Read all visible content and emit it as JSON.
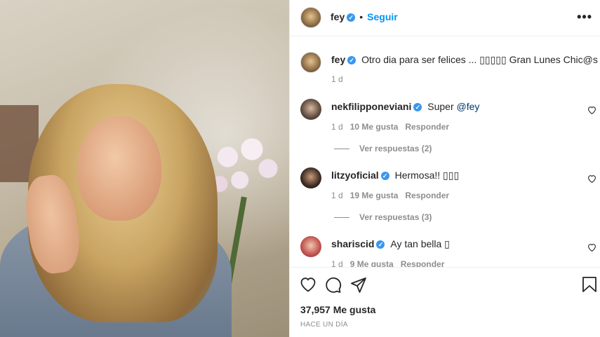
{
  "post": {
    "photo_alt": "post-photo",
    "author": "fey",
    "follow_label": "Seguir",
    "more_label": "•••"
  },
  "caption": {
    "author": "fey",
    "text": "Otro dia para ser felices ... ▯▯▯▯▯ Gran Lunes Chic@s !!!",
    "time": "1 d"
  },
  "comments": [
    {
      "author": "nekfilipponeviani",
      "text_prefix": "Super ",
      "mention": "@fey",
      "time": "1 d",
      "likes": "10 Me gusta",
      "reply_label": "Responder",
      "view_replies": "Ver respuestas (2)"
    },
    {
      "author": "litzyoficial",
      "text_prefix": "Hermosa!! ▯▯▯",
      "mention": "",
      "time": "1 d",
      "likes": "19 Me gusta",
      "reply_label": "Responder",
      "view_replies": "Ver respuestas (3)"
    },
    {
      "author": "shariscid",
      "text_prefix": "Ay tan bella ▯",
      "mention": "",
      "time": "1 d",
      "likes": "9 Me gusta",
      "reply_label": "Responder",
      "view_replies": ""
    }
  ],
  "footer": {
    "likes_count": "37,957 Me gusta",
    "timestamp": "HACE UN DÍA"
  },
  "colors": {
    "accent": "#0095f6",
    "verified": "#3897f0",
    "secondary_text": "#8e8e8e"
  }
}
